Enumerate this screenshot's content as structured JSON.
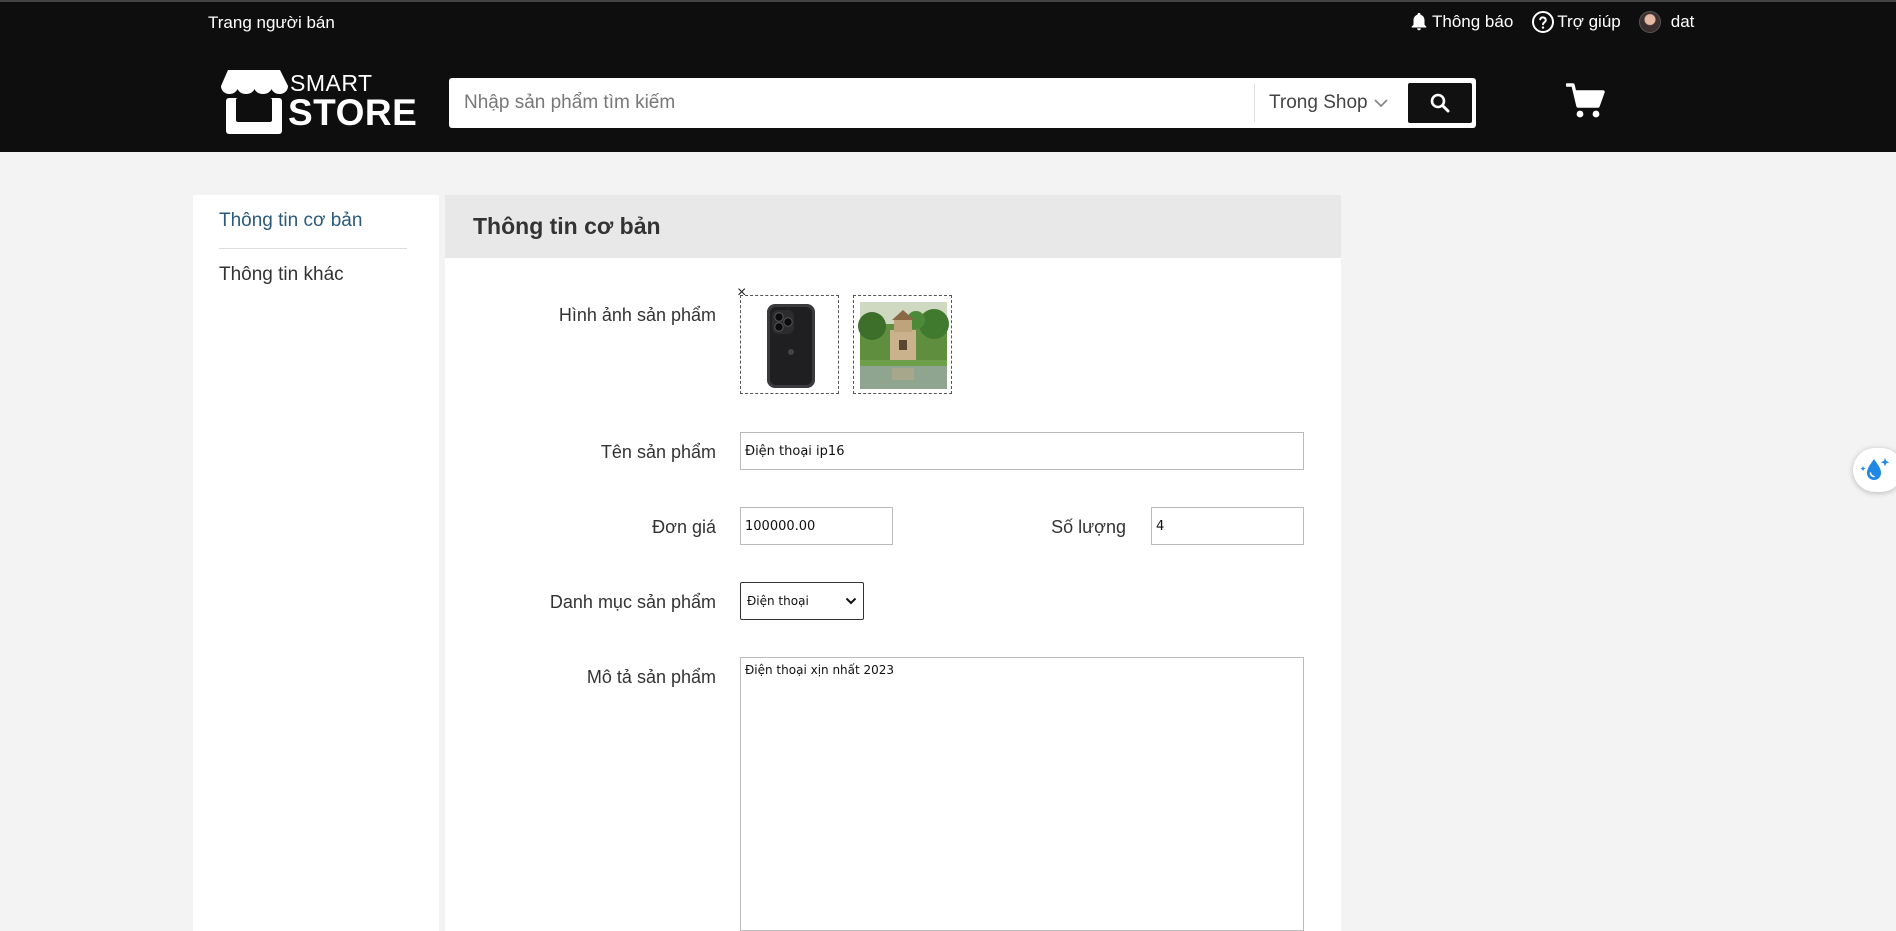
{
  "header": {
    "seller_link": "Trang người bán",
    "notifications_label": "Thông báo",
    "help_label": "Trợ giúp",
    "user_name": "dat",
    "logo_top": "SMART",
    "logo_bottom": "STORE",
    "search": {
      "placeholder": "Nhập sản phẩm tìm kiếm",
      "scope_value": "Trong Shop"
    }
  },
  "sidebar": {
    "items": [
      {
        "label": "Thông tin cơ bản",
        "active": true
      },
      {
        "label": "Thông tin khác",
        "active": false
      }
    ]
  },
  "main": {
    "title": "Thông tin cơ bản",
    "form": {
      "images_label": "Hình ảnh sản phẩm",
      "remove_symbol": "×",
      "name_label": "Tên sản phẩm",
      "name_value": "Điện thoại ip16",
      "price_label": "Đơn giá",
      "price_value": "100000.00",
      "qty_label": "Số lượng",
      "qty_value": "4",
      "category_label": "Danh mục sản phẩm",
      "category_value": "Điện thoại",
      "description_label": "Mô tả sản phẩm",
      "description_value": "Điện thoại xịn nhất 2023"
    }
  },
  "colors": {
    "header_bg": "#0e0e0e",
    "page_bg": "#f3f3f3",
    "active_link": "#2b5a7a"
  },
  "icons": [
    "store-logo-icon",
    "bell-icon",
    "help-circle-icon",
    "avatar",
    "chevron-down-icon",
    "search-icon",
    "cart-icon",
    "water-drop-sparkle-icon"
  ]
}
